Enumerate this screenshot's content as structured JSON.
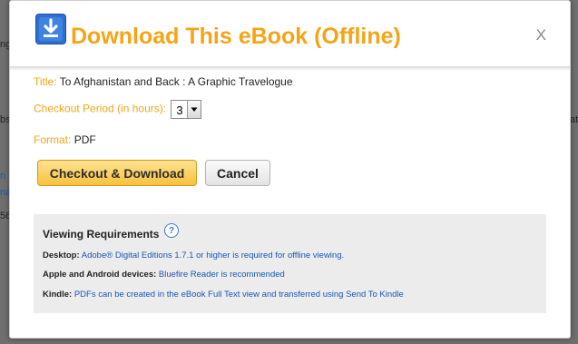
{
  "backdrop": {
    "frag1": "ng",
    "frag2": "bs",
    "frag3": "n",
    "frag4": "na",
    "frag5": "56",
    "frag6": "at"
  },
  "dialog": {
    "title": "Download This eBook (Offline)",
    "close_label": "X",
    "fields": {
      "title_label": "Title:",
      "title_value": "To Afghanistan and Back : A Graphic Travelogue",
      "checkout_label": "Checkout Period (in hours):",
      "checkout_value": "3",
      "format_label": "Format:",
      "format_value": "PDF"
    },
    "buttons": {
      "checkout_download": "Checkout & Download",
      "cancel": "Cancel"
    },
    "requirements": {
      "heading": "Viewing Requirements",
      "help_glyph": "?",
      "lines": [
        {
          "label": "Desktop:",
          "text": "Adobe® Digital Editions 1.7.1 or higher is required for offline viewing."
        },
        {
          "label": "Apple and Android devices:",
          "text": "Bluefire Reader is recommended"
        },
        {
          "label": "Kindle:",
          "text": "PDFs can be created in the eBook Full Text view and transferred using Send To Kindle"
        }
      ]
    }
  },
  "colors": {
    "accent": "#f5a418",
    "link": "#1a55b5",
    "overlay": "#6f6f6f"
  },
  "icons": [
    "download-icon",
    "help-icon",
    "dropdown-arrow-icon"
  ]
}
